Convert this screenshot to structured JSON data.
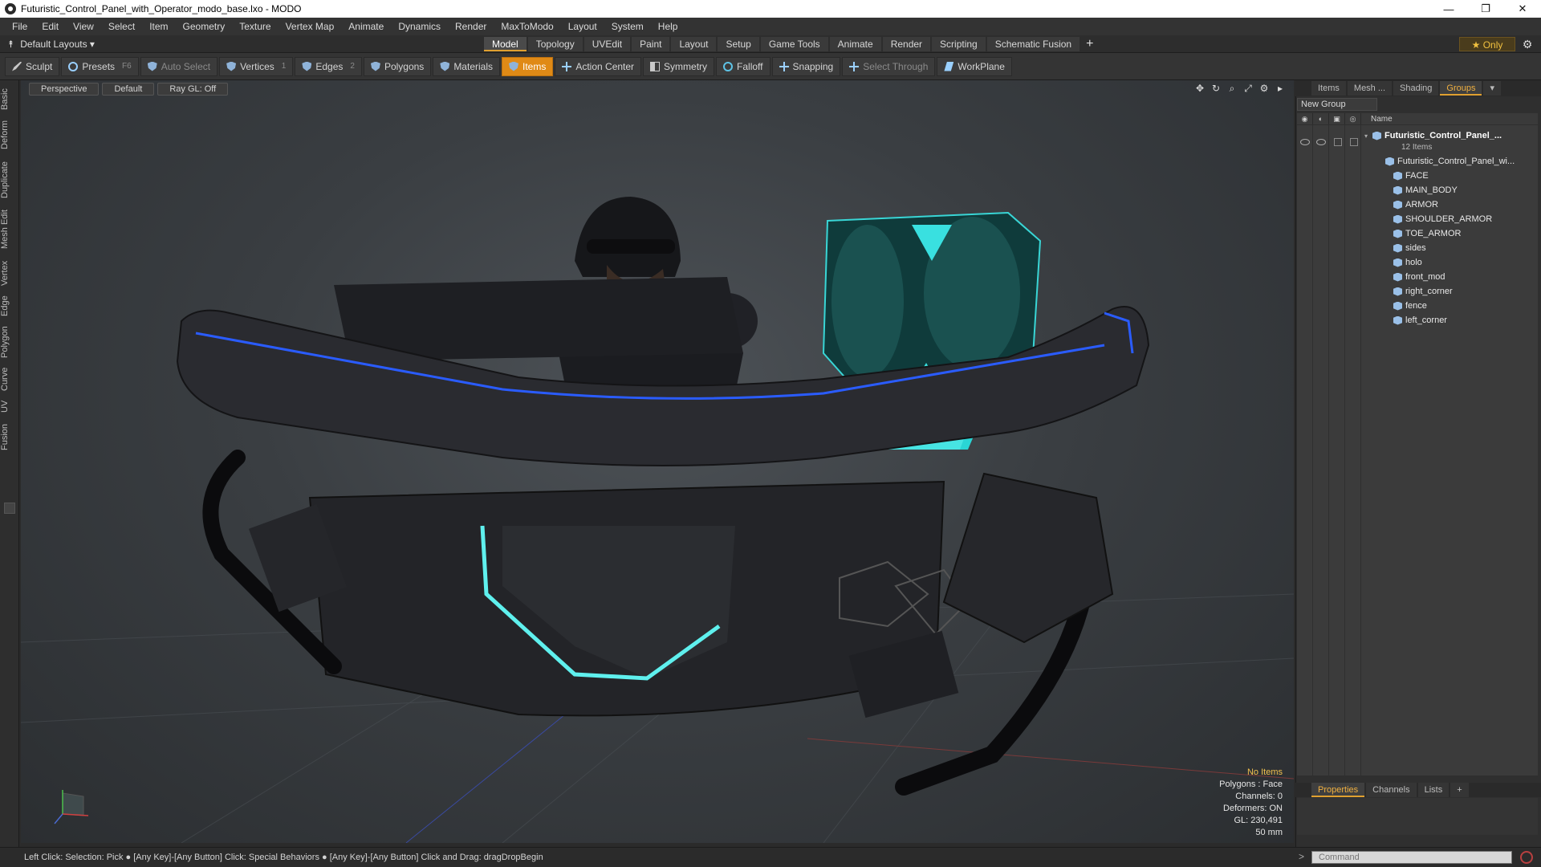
{
  "window": {
    "title": "Futuristic_Control_Panel_with_Operator_modo_base.lxo - MODO",
    "controls": [
      "—",
      "❐",
      "✕"
    ]
  },
  "menu": [
    "File",
    "Edit",
    "View",
    "Select",
    "Item",
    "Geometry",
    "Texture",
    "Vertex Map",
    "Animate",
    "Dynamics",
    "Render",
    "MaxToModo",
    "Layout",
    "System",
    "Help"
  ],
  "layoutbar": {
    "layouts_label": "Default Layouts ▾",
    "tabs": [
      "Model",
      "Topology",
      "UVEdit",
      "Paint",
      "Layout",
      "Setup",
      "Game Tools",
      "Animate",
      "Render",
      "Scripting",
      "Schematic Fusion"
    ],
    "active_tab": "Model",
    "only_label": "★  Only"
  },
  "toolbar": {
    "sculpt": "Sculpt",
    "presets": "Presets",
    "presets_key": "F6",
    "auto_select": "Auto Select",
    "vertices": "Vertices",
    "vertices_key": "1",
    "edges": "Edges",
    "edges_key": "2",
    "polygons": "Polygons",
    "materials": "Materials",
    "items": "Items",
    "action_center": "Action Center",
    "symmetry": "Symmetry",
    "falloff": "Falloff",
    "snapping": "Snapping",
    "select_through": "Select Through",
    "workplane": "WorkPlane"
  },
  "left_tabs": [
    "Basic",
    "Deform",
    "Duplicate",
    "Mesh Edit",
    "Vertex",
    "Edge",
    "Polygon",
    "Curve",
    "UV",
    "Fusion"
  ],
  "viewport": {
    "view": "Perspective",
    "style": "Default",
    "raygl": "Ray GL: Off",
    "info": {
      "no_items": "No Items",
      "polygons": "Polygons : Face",
      "channels": "Channels: 0",
      "deformers": "Deformers: ON",
      "gl": "GL: 230,491",
      "scale": "50 mm"
    }
  },
  "right_panel": {
    "tabs": [
      "Items",
      "Mesh ...",
      "Shading",
      "Groups"
    ],
    "active_tab": "Groups",
    "new_group": "New Group",
    "name_header": "Name",
    "group_name": "Futuristic_Control_Panel_...",
    "group_count": "12 Items",
    "items": [
      "Futuristic_Control_Panel_wi...",
      "FACE",
      "MAIN_BODY",
      "ARMOR",
      "SHOULDER_ARMOR",
      "TOE_ARMOR",
      "sides",
      "holo",
      "front_mod",
      "right_corner",
      "fence",
      "left_corner"
    ]
  },
  "properties_tabs": [
    "Properties",
    "Channels",
    "Lists"
  ],
  "status": "Left Click: Selection: Pick ●  [Any Key]-[Any Button] Click: Special Behaviors ●  [Any Key]-[Any Button] Click and Drag: dragDropBegin",
  "command": {
    "prompt": ">",
    "placeholder": "Command"
  }
}
